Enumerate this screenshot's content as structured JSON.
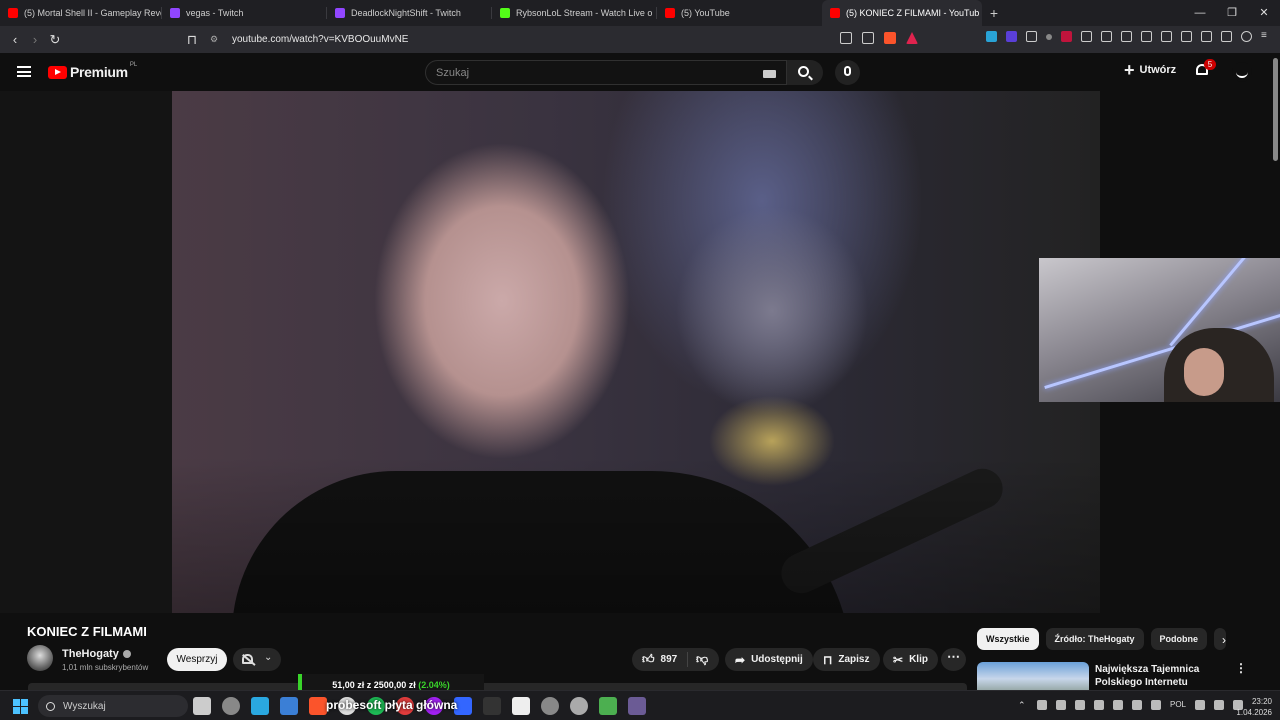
{
  "browser": {
    "tabs": [
      {
        "title": "(5) Mortal Shell II - Gameplay Reveal",
        "favicon": "youtube-icon",
        "color": "#ff0000"
      },
      {
        "title": "vegas - Twitch",
        "favicon": "twitch-icon",
        "color": "#9146ff"
      },
      {
        "title": "DeadlockNightShift - Twitch",
        "favicon": "twitch-icon",
        "color": "#9146ff"
      },
      {
        "title": "RybsonLoL Stream - Watch Live o",
        "favicon": "kick-icon",
        "color": "#53fc18"
      },
      {
        "title": "(5) YouTube",
        "favicon": "youtube-icon",
        "color": "#ff0000"
      },
      {
        "title": "(5) KONIEC Z FILMAMI - YouTub",
        "favicon": "youtube-icon",
        "color": "#ff0000",
        "active": true
      }
    ],
    "url": "youtube.com/watch?v=KVBOOuuMvNE"
  },
  "youtube": {
    "logo_text": "Premium",
    "logo_country": "PL",
    "search_placeholder": "Szukaj",
    "create_label": "Utwórz",
    "notification_count": "5"
  },
  "video": {
    "title": "KONIEC Z FILMAMI",
    "channel": "TheHogaty",
    "subscribers": "1,01 mln subskrybentów",
    "join_label": "Wesprzyj",
    "likes": "897",
    "share_label": "Udostępnij",
    "save_label": "Zapisz",
    "clip_label": "Klip"
  },
  "sidebar": {
    "chips": [
      "Wszystkie",
      "Źródło: TheHogaty",
      "Podobne"
    ],
    "recommended": [
      {
        "title_line1": "Największa Tajemnica",
        "title_line2": "Polskiego Internetu"
      }
    ]
  },
  "overlay": {
    "donation_text": "51,00 zł z 2500,00 zł",
    "donation_percent": "(2.04%)",
    "donation_fraction": 0.0204
  },
  "taskbar": {
    "search_placeholder": "Wyszukaj",
    "window_title": "probesoft płyta główna",
    "language": "POL",
    "time": "23:20",
    "date": "1.04.2026"
  },
  "colors": {
    "accent_red": "#ff0000",
    "donation_green": "#39d42a",
    "background": "#0f0f0f"
  }
}
